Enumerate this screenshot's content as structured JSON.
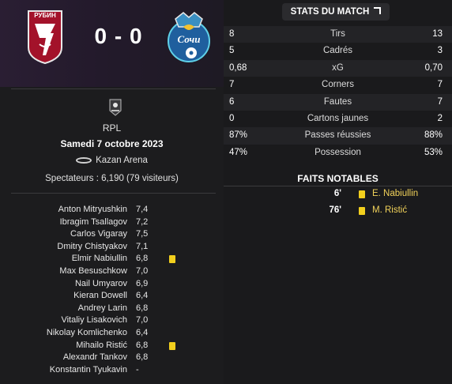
{
  "match": {
    "home_team_crest": "rubin-kazan-crest",
    "home_crest_text": "РУБИН",
    "away_team_crest": "sochi-crest",
    "away_crest_text": "Сочи",
    "score": "0 - 0",
    "league": "RPL",
    "date": "Samedi 7 octobre 2023",
    "venue": "Kazan Arena",
    "spectators": "Spectateurs : 6,190 (79 visiteurs)"
  },
  "players": [
    {
      "name": "Anton Mitryushkin",
      "rating": "7,4",
      "card": false
    },
    {
      "name": "Ibragim Tsallagov",
      "rating": "7,2",
      "card": false
    },
    {
      "name": "Carlos Vigaray",
      "rating": "7,5",
      "card": false
    },
    {
      "name": "Dmitry Chistyakov",
      "rating": "7,1",
      "card": false
    },
    {
      "name": "Elmir Nabiullin",
      "rating": "6,8",
      "card": true
    },
    {
      "name": "Max Besuschkow",
      "rating": "7,0",
      "card": false
    },
    {
      "name": "Nail Umyarov",
      "rating": "6,9",
      "card": false
    },
    {
      "name": "Kieran Dowell",
      "rating": "6,4",
      "card": false
    },
    {
      "name": "Andrey Larin",
      "rating": "6,8",
      "card": false
    },
    {
      "name": "Vitaliy Lisakovich",
      "rating": "7,0",
      "card": false
    },
    {
      "name": "Nikolay Komlichenko",
      "rating": "6,4",
      "card": false
    },
    {
      "name": "Mihailo Ristić",
      "rating": "6,8",
      "card": true
    },
    {
      "name": "Alexandr Tankov",
      "rating": "6,8",
      "card": false
    },
    {
      "name": "Konstantin Tyukavin",
      "rating": "-",
      "card": false
    }
  ],
  "stats_tab": {
    "label": "STATS DU MATCH"
  },
  "stats": [
    {
      "label": "Tirs",
      "home": "8",
      "away": "13"
    },
    {
      "label": "Cadrés",
      "home": "5",
      "away": "3"
    },
    {
      "label": "xG",
      "home": "0,68",
      "away": "0,70"
    },
    {
      "label": "Corners",
      "home": "7",
      "away": "7"
    },
    {
      "label": "Fautes",
      "home": "6",
      "away": "7"
    },
    {
      "label": "Cartons jaunes",
      "home": "0",
      "away": "2"
    },
    {
      "label": "Passes réussies",
      "home": "87%",
      "away": "88%"
    },
    {
      "label": "Possession",
      "home": "47%",
      "away": "53%"
    }
  ],
  "notable": {
    "title": "FAITS NOTABLES",
    "events": [
      {
        "minute": "6'",
        "type": "yellow-card",
        "player": "E. Nabiullin"
      },
      {
        "minute": "76'",
        "type": "yellow-card",
        "player": "M. Ristić"
      }
    ]
  },
  "colors": {
    "background": "#1b1b1d",
    "header_band": "#2a1e33",
    "home_red": "#a3122a",
    "away_blue": "#1f5f9e",
    "yellow_card": "#f2cf1d",
    "event_player": "#f2d25a"
  }
}
